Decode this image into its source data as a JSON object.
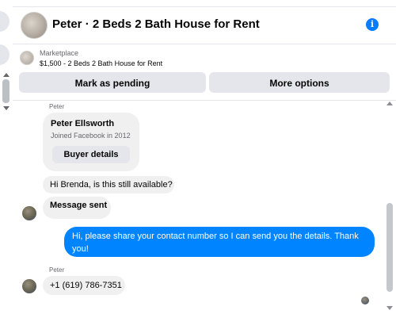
{
  "header": {
    "title": "Peter · 2 Beds 2 Bath House for Rent",
    "avatar_icon": "listing-photo",
    "info_icon_glyph": "i"
  },
  "listing": {
    "source_label": "Marketplace",
    "price_title": "$1,500 - 2 Beds 2 Bath House for Rent",
    "mark_pending_label": "Mark as pending",
    "more_options_label": "More options"
  },
  "conversation": {
    "sender_name_1": "Peter",
    "profile_card": {
      "name": "Peter Ellsworth",
      "joined": "Joined Facebook in 2012",
      "button_label": "Buyer details"
    },
    "messages": [
      {
        "from": "Peter",
        "text": "Hi Brenda, is this still available?"
      },
      {
        "from": "Peter",
        "text": "Message sent"
      },
      {
        "from": "me",
        "text": "Hi, please share your contact number so I can send you the details. Thank you!"
      },
      {
        "from": "Peter",
        "text": "+1 (619) 786-7351"
      }
    ],
    "sender_name_2": "Peter"
  },
  "colors": {
    "accent_blue": "#0084ff",
    "info_blue": "#0a7cff",
    "grey_bubble": "#f0f0f0",
    "button_grey": "#e4e6eb"
  }
}
